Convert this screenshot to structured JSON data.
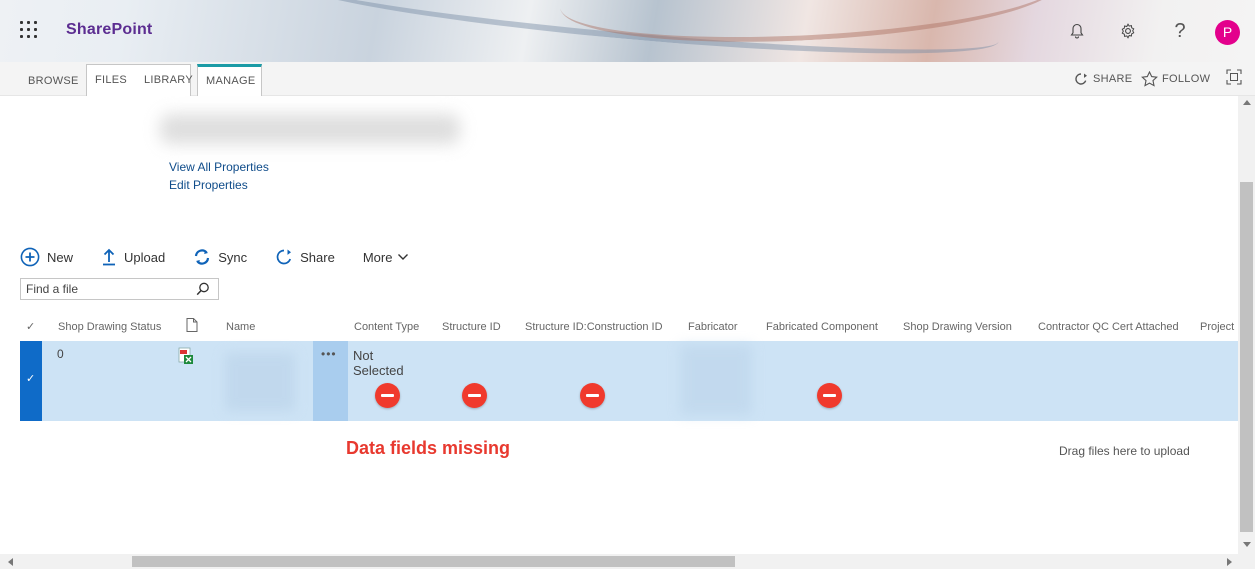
{
  "suite": {
    "brand": "SharePoint",
    "avatar_initial": "P",
    "icons": [
      "app-launcher-icon",
      "bell-icon",
      "gear-icon",
      "help-icon"
    ]
  },
  "ribbon": {
    "tabs": [
      "BROWSE",
      "FILES",
      "LIBRARY",
      "MANAGE"
    ],
    "share_label": "SHARE",
    "follow_label": "FOLLOW"
  },
  "properties": {
    "view_all": "View All Properties",
    "edit": "Edit Properties"
  },
  "commands": {
    "new": "New",
    "upload": "Upload",
    "sync": "Sync",
    "share": "Share",
    "more": "More"
  },
  "search": {
    "placeholder": "Find a file"
  },
  "table": {
    "columns": [
      "Shop Drawing Status",
      "Name",
      "Content Type",
      "Structure ID",
      "Structure ID:Construction ID",
      "Fabricator",
      "Fabricated Component",
      "Shop Drawing Version",
      "Contractor QC Cert Attached",
      "Project"
    ],
    "row": {
      "status": "0",
      "content_type": "Not Selected",
      "content_type_line1": "Not",
      "content_type_line2": "Selected"
    }
  },
  "annotation": {
    "text": "Data fields missing"
  },
  "drop_hint": "Drag files here to upload",
  "colors": {
    "brand": "#5c2d91",
    "accent": "#0f6bc8",
    "selected_row": "#cde3f5",
    "annotation": "#e8392f",
    "avatar": "#e3008c"
  }
}
